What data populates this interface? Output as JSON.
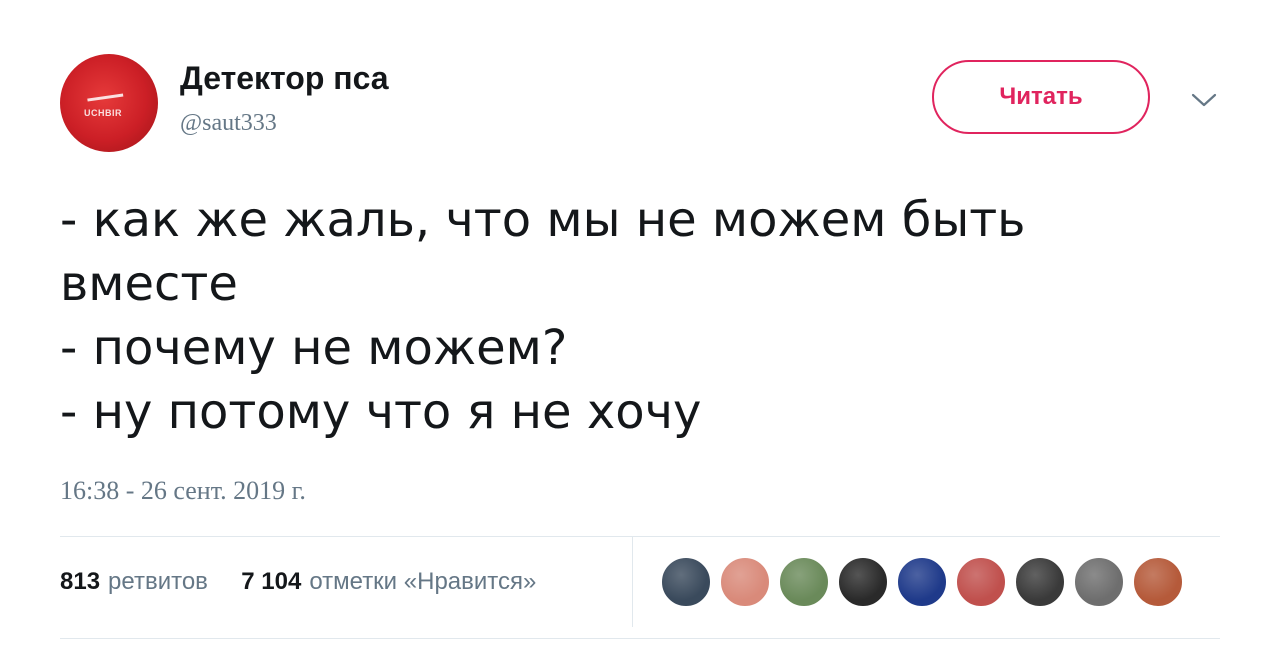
{
  "user": {
    "display_name": "Детектор пса",
    "handle": "@saut333",
    "avatar_text": "UCHBIR"
  },
  "follow_button_label": "Читать",
  "tweet": {
    "lines": [
      "- как же жаль, что мы не можем быть",
      "вместе",
      "- почему не можем?",
      "- ну потому что я не хочу"
    ],
    "timestamp": "16:38 - 26 сент. 2019 г."
  },
  "stats": {
    "retweets_count": "813",
    "retweets_label": "ретвитов",
    "likes_count": "7 104",
    "likes_label": "отметки «Нравится»"
  },
  "likers": [
    {
      "icon": "liker-avatar-1",
      "color": "#3a4a5c"
    },
    {
      "icon": "liker-avatar-2",
      "color": "#d98a7a"
    },
    {
      "icon": "liker-avatar-3",
      "color": "#6a8a5a"
    },
    {
      "icon": "liker-avatar-4",
      "color": "#2a2a2a"
    },
    {
      "icon": "liker-avatar-5",
      "color": "#1f3a8a"
    },
    {
      "icon": "liker-avatar-6",
      "color": "#c0504d"
    },
    {
      "icon": "liker-avatar-7",
      "color": "#3a3a3a"
    },
    {
      "icon": "liker-avatar-8",
      "color": "#6e6e6e"
    },
    {
      "icon": "liker-avatar-9",
      "color": "#b55a3a"
    }
  ],
  "colors": {
    "accent": "#e0245e",
    "text_primary": "#14171a",
    "text_secondary": "#657786",
    "divider": "#e1e8ed"
  }
}
